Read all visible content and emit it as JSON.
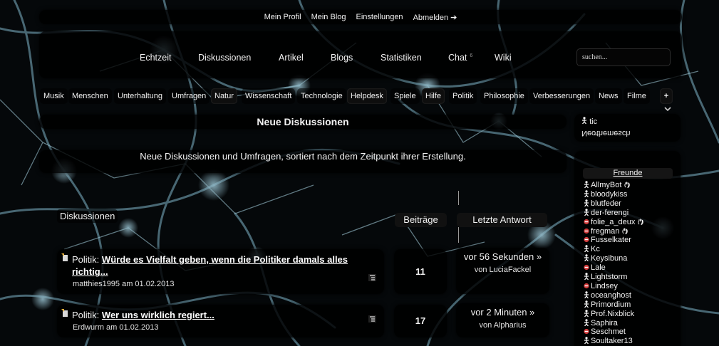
{
  "top_menu": [
    "Mein Profil",
    "Mein Blog",
    "Einstellungen",
    "Abmelden ➔"
  ],
  "main_nav": [
    {
      "label": "Echtzeit",
      "badge": ""
    },
    {
      "label": "Diskussionen",
      "badge": ""
    },
    {
      "label": "Artikel",
      "badge": ""
    },
    {
      "label": "Blogs",
      "badge": ""
    },
    {
      "label": "Statistiken",
      "badge": ""
    },
    {
      "label": "Chat",
      "badge": "6"
    },
    {
      "label": "Wiki",
      "badge": ""
    }
  ],
  "search": {
    "placeholder": "suchen..."
  },
  "categories": [
    {
      "label": "Musik",
      "boxed": false
    },
    {
      "label": "Menschen",
      "boxed": false
    },
    {
      "label": "Unterhaltung",
      "boxed": false
    },
    {
      "label": "Umfragen",
      "boxed": false
    },
    {
      "label": "Natur",
      "boxed": true
    },
    {
      "label": "Wissenschaft",
      "boxed": false
    },
    {
      "label": "Technologie",
      "boxed": false
    },
    {
      "label": "Helpdesk",
      "boxed": true
    },
    {
      "label": "Spiele",
      "boxed": false
    },
    {
      "label": "Hilfe",
      "boxed": true
    },
    {
      "label": "Politik",
      "boxed": false
    },
    {
      "label": "Philosophie",
      "boxed": false
    },
    {
      "label": "Verbesserungen",
      "boxed": false
    },
    {
      "label": "News",
      "boxed": false
    },
    {
      "label": "Filme",
      "boxed": false
    }
  ],
  "category_more": "+",
  "page": {
    "heading": "Neue Diskussionen",
    "description": "Neue Diskussionen und Umfragen, sortiert nach dem Zeitpunkt ihrer Erstellung."
  },
  "columns": {
    "discussions": "Diskussionen",
    "posts": "Beiträge",
    "last_reply": "Letzte Antwort"
  },
  "discussions": [
    {
      "category": "Politik:",
      "title": "Würde es Vielfalt geben, wenn die Politiker damals alles richtig...",
      "meta": "matthies1995 am 01.02.2013",
      "count": "11",
      "last_when": "vor 56 Sekunden »",
      "last_by": "von LuciaFackel"
    },
    {
      "category": "Politik:",
      "title": "Wer uns wirklich regiert...",
      "meta": "Erdwurm am 01.02.2013",
      "count": "17",
      "last_when": "vor 2 Minuten »",
      "last_by": "von Alpharius"
    }
  ],
  "sidebar": {
    "status_user": "tic",
    "status_flipped": "Neσthemesch",
    "friends_title": "Freunde",
    "friends": [
      {
        "name": "AllmyBot",
        "status": "online",
        "extra": true
      },
      {
        "name": "bloodykiss",
        "status": "online",
        "extra": false
      },
      {
        "name": "blutfeder",
        "status": "online",
        "extra": false
      },
      {
        "name": "der-ferengi",
        "status": "online",
        "extra": false
      },
      {
        "name": "folie_a_deux",
        "status": "busy",
        "extra": true
      },
      {
        "name": "fregman",
        "status": "busy",
        "extra": true
      },
      {
        "name": "Fusselkater",
        "status": "busy",
        "extra": false
      },
      {
        "name": "Kc",
        "status": "online",
        "extra": false
      },
      {
        "name": "Keysibuna",
        "status": "online",
        "extra": false
      },
      {
        "name": "Lale",
        "status": "busy",
        "extra": false
      },
      {
        "name": "Lightstorm",
        "status": "online",
        "extra": false
      },
      {
        "name": "Lindsey",
        "status": "busy",
        "extra": false
      },
      {
        "name": "oceanghost",
        "status": "online",
        "extra": false
      },
      {
        "name": "Primordium",
        "status": "online",
        "extra": false
      },
      {
        "name": "Prof.Nixblick",
        "status": "online",
        "extra": false
      },
      {
        "name": "Saphira",
        "status": "online",
        "extra": false
      },
      {
        "name": "Seschmet",
        "status": "busy",
        "extra": false
      },
      {
        "name": "Soultaker13",
        "status": "online",
        "extra": false
      }
    ]
  },
  "colors": {
    "busy": "#d23a3a",
    "panel": "#000000"
  }
}
